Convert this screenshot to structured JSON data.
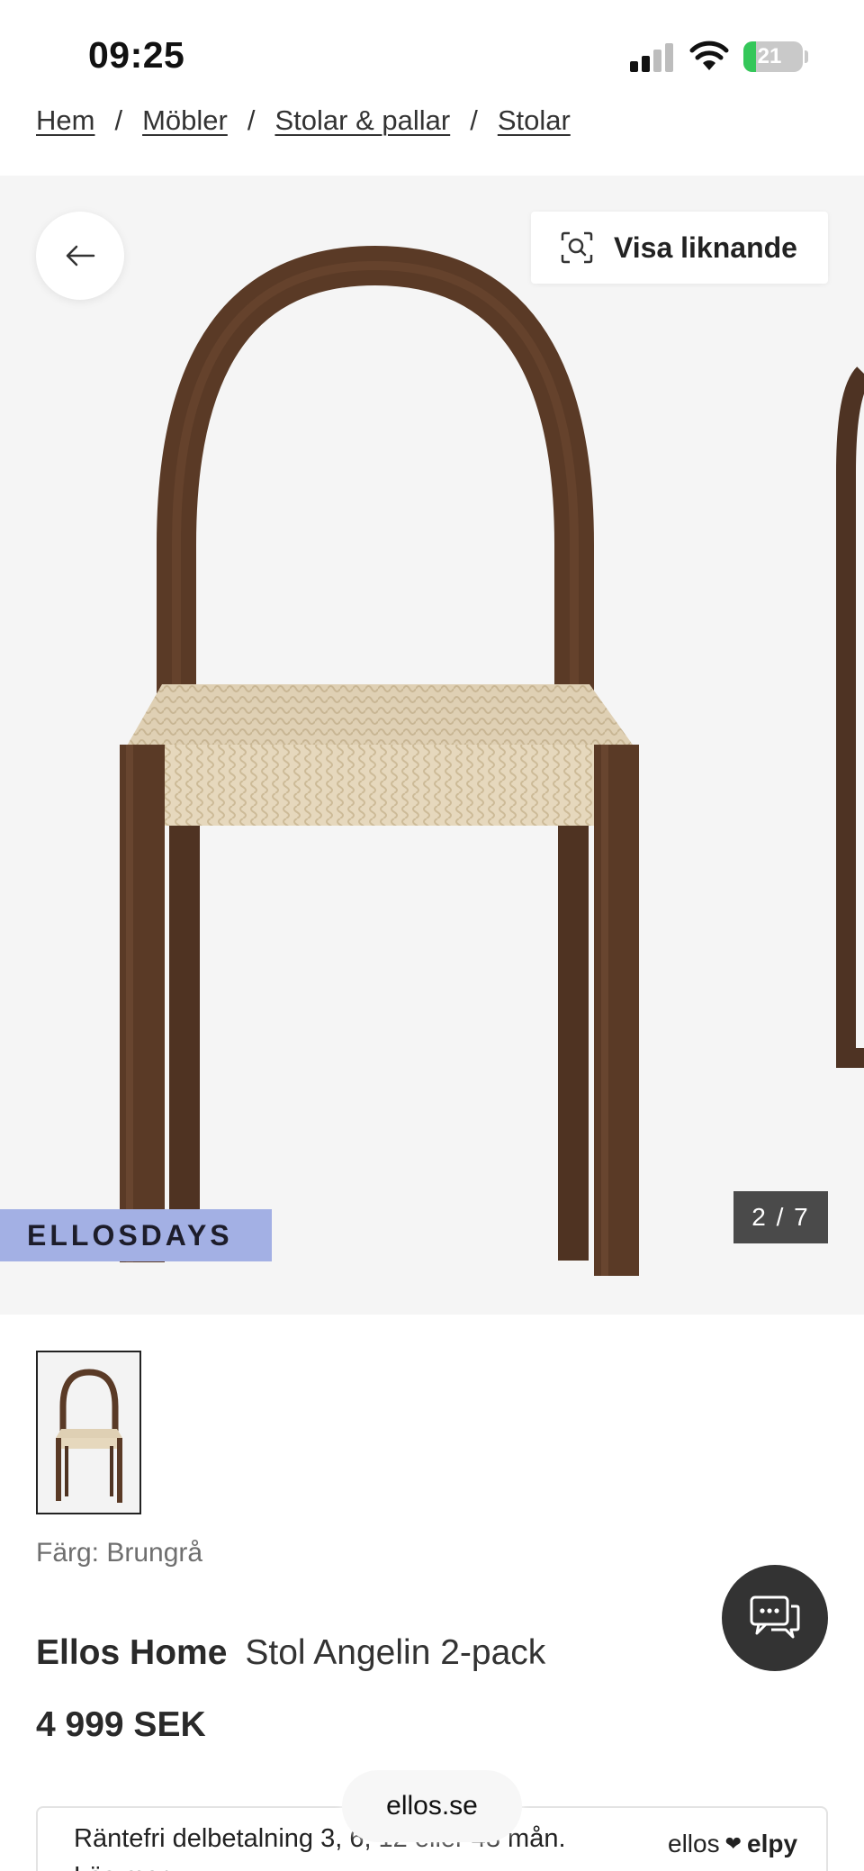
{
  "status_bar": {
    "time": "09:25",
    "battery": "21"
  },
  "breadcrumb": [
    {
      "label": "Hem"
    },
    {
      "label": "Möbler"
    },
    {
      "label": "Stolar & pallar"
    },
    {
      "label": "Stolar"
    }
  ],
  "breadcrumb_separator": "/",
  "gallery": {
    "similar_label": "Visa liknande",
    "promo_tag": "ELLOSDAYS",
    "counter": "2 / 7"
  },
  "product": {
    "color_label": "Färg: Brungrå",
    "brand": "Ellos Home",
    "name": "Stol Angelin 2-pack",
    "price": "4 999 SEK"
  },
  "payment": {
    "text": "Räntefri delbetalning 3, 6, 12 eller 48 mån.",
    "more": "Läs mer",
    "brand_left": "ellos",
    "brand_right": "elpy"
  },
  "browser": {
    "url": "ellos.se"
  },
  "colors": {
    "promo_bg": "#a3b0e4",
    "gallery_bg": "#f5f5f5",
    "wood": "#5a3a26",
    "rope": "#dfd0b4"
  },
  "icons": {
    "back": "arrow-left-icon",
    "similar": "visual-search-icon",
    "chat": "chat-bubbles-icon"
  }
}
